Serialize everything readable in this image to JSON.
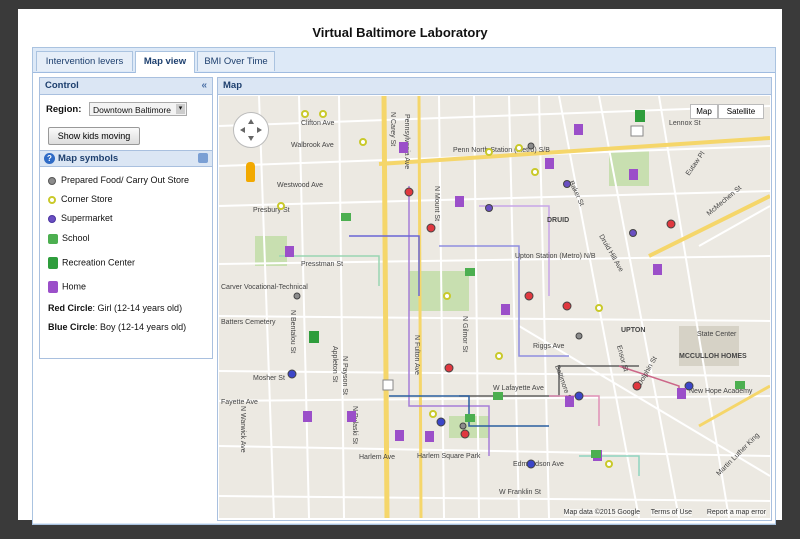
{
  "title": "Virtual Baltimore Laboratory",
  "tabs": [
    {
      "label": "Intervention levers"
    },
    {
      "label": "Map view"
    },
    {
      "label": "BMI Over Time"
    }
  ],
  "control": {
    "header": "Control",
    "region_label": "Region:",
    "region_value": "Downtown Baltimore",
    "show_kids_button": "Show kids moving"
  },
  "legend": {
    "header": "Map symbols",
    "items": [
      {
        "label": "Prepared Food/ Carry Out Store"
      },
      {
        "label": "Corner Store"
      },
      {
        "label": "Supermarket"
      },
      {
        "label": "School"
      },
      {
        "label": "Recreation Center"
      },
      {
        "label": "Home"
      }
    ],
    "red_circle_label": "Red Circle",
    "red_circle_text": ": Girl (12-14 years old)",
    "blue_circle_label": "Blue Circle",
    "blue_circle_text": ": Boy (12-14 years old)",
    "colors": {
      "prepared_food": "#8c8c8c",
      "corner_store": "#c9c92a",
      "supermarket": "#6a4fc2",
      "school": "#4caf50",
      "recreation": "#2e9d3c",
      "home": "#9b4fc9",
      "girl": "#e0383f",
      "boy": "#3c46c8"
    }
  },
  "map": {
    "header": "Map",
    "type_map": "Map",
    "type_satellite": "Satellite",
    "footer_data": "Map data ©2015 Google",
    "footer_terms": "Terms of Use",
    "footer_report": "Report a map error",
    "street_labels": [
      "Clifton Ave",
      "Walbrook Ave",
      "Westwood Ave",
      "Presbury St",
      "N Fulton Ave",
      "N Mount St",
      "N Carey St",
      "Pennsylvania Ave",
      "Druid Hill Ave",
      "Presstman St",
      "Penn North Station (Metro) S/B",
      "Upton Station (Metro) N/B",
      "Carver Vocational-Technical",
      "Mosher St",
      "W Lafayette Ave",
      "Harlem Ave",
      "Harlem Square Park",
      "Edmondson Ave",
      "W Franklin St",
      "Riggs Ave",
      "Lennox St",
      "State Center",
      "UPTON",
      "MCCULLOH HOMES",
      "New Hope Academy",
      "Dolphin St",
      "Ensor St",
      "Baker St",
      "N Gilmor St",
      "N Payson St",
      "N Pulaski St",
      "N Warwick Ave",
      "Appleton St",
      "Baltimore St",
      "Eutaw Pl",
      "McMechen St",
      "Martin Luther King",
      "DRUID",
      "Fayette Ave",
      "N Bentalou St",
      "Batters Cemetery"
    ]
  }
}
